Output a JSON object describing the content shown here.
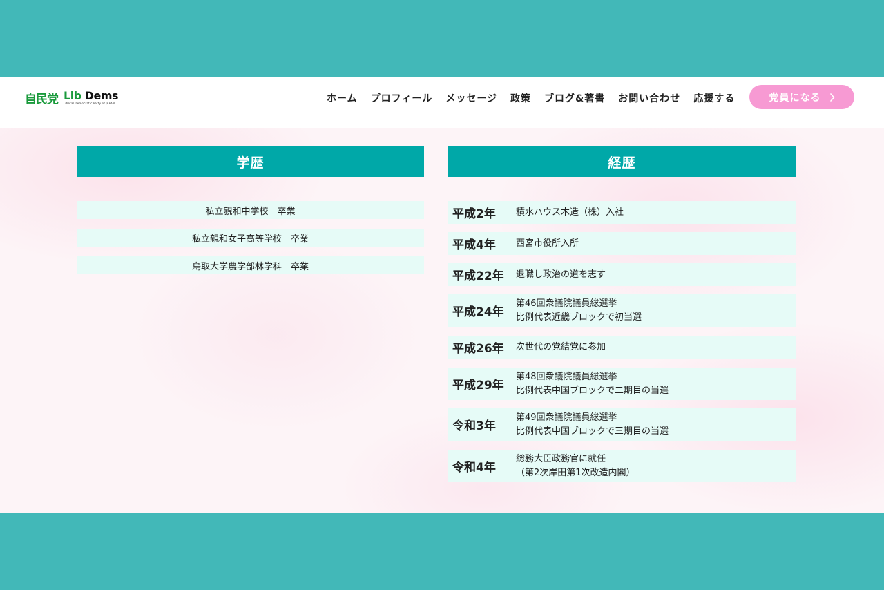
{
  "header": {
    "logo_ldp": "自民党",
    "logo_lib_main_1": "Lib",
    "logo_lib_main_2": "Dems",
    "logo_lib_sub": "Liberal Democratic Party of JAPAN",
    "nav": [
      "ホーム",
      "プロフィール",
      "メッセージ",
      "政策",
      "ブログ&著書",
      "お問い合わせ",
      "応援する"
    ],
    "cta_label": "党員になる",
    "cta_icon": "chevron-right-icon",
    "cta_color": "#f79ad3"
  },
  "education": {
    "title": "学歴",
    "items": [
      "私立親和中学校　卒業",
      "私立親和女子高等学校　卒業",
      "鳥取大学農学部林学科　卒業"
    ]
  },
  "career": {
    "title": "経歴",
    "items": [
      {
        "year": "平成2年",
        "lines": [
          "積水ハウス木造（株）入社"
        ]
      },
      {
        "year": "平成4年",
        "lines": [
          "西宮市役所入所"
        ]
      },
      {
        "year": "平成22年",
        "lines": [
          "退職し政治の道を志す"
        ]
      },
      {
        "year": "平成24年",
        "lines": [
          "第46回衆議院議員総選挙",
          "比例代表近畿ブロックで初当選"
        ]
      },
      {
        "year": "平成26年",
        "lines": [
          "次世代の党結党に参加"
        ]
      },
      {
        "year": "平成29年",
        "lines": [
          "第48回衆議院議員総選挙",
          "比例代表中国ブロックで二期目の当選"
        ]
      },
      {
        "year": "令和3年",
        "lines": [
          "第49回衆議院議員総選挙",
          "比例代表中国ブロックで三期目の当選"
        ]
      },
      {
        "year": "令和4年",
        "lines": [
          "総務大臣政務官に就任",
          "（第2次岸田第1次改造内閣）"
        ]
      }
    ]
  },
  "colors": {
    "outer_bg": "#42b8b8",
    "accent": "#00a8a8",
    "row_bg": "#e6fbf7"
  }
}
